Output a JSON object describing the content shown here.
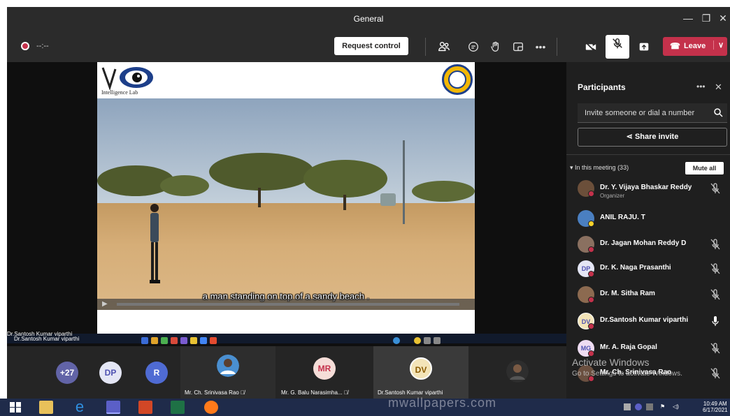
{
  "window": {
    "title": "General"
  },
  "toolbar": {
    "timer": "--:--",
    "request_control_label": "Request control",
    "leave_label": "Leave"
  },
  "slide": {
    "lab_name": "Intelligence Lab",
    "caption": "a man standing on top of a sandy beach ."
  },
  "presenter_name": "Dr.Santosh Kumar viparthi",
  "panel": {
    "title": "Participants",
    "search_placeholder": "Invite someone or dial a number",
    "share_invite_label": "Share invite",
    "in_meeting_label": "In this meeting (33)",
    "mute_all_label": "Mute all",
    "participants": [
      {
        "name": "Dr. Y. Vijaya Bhaskar Reddy",
        "role": "Organizer",
        "initials": "",
        "avatar_color": "#6b4f3a",
        "mic": "muted"
      },
      {
        "name": "ANIL RAJU. T",
        "role": "",
        "initials": "",
        "avatar_color": "#4a7fc1",
        "mic": "none"
      },
      {
        "name": "Dr. Jagan Mohan Reddy D",
        "role": "",
        "initials": "",
        "avatar_color": "#8a7060",
        "mic": "muted"
      },
      {
        "name": "Dr. K. Naga Prasanthi",
        "role": "",
        "initials": "DP",
        "avatar_color": "#e4e6f5",
        "mic": "muted"
      },
      {
        "name": "Dr. M. Sitha Ram",
        "role": "",
        "initials": "",
        "avatar_color": "#8c6a50",
        "mic": "muted"
      },
      {
        "name": "Dr.Santosh Kumar viparthi",
        "role": "",
        "initials": "DV",
        "avatar_color": "#f3e4b8",
        "mic": "on"
      },
      {
        "name": "Mr. A. Raja Gopal",
        "role": "",
        "initials": "MG",
        "avatar_color": "#eedcf2",
        "mic": "muted"
      },
      {
        "name": "Mr. Ch. Srinivasa Rao",
        "role": "",
        "initials": "",
        "avatar_color": "#6b5040",
        "mic": "muted"
      }
    ]
  },
  "gallery": {
    "overflow_label": "+27",
    "tiles": [
      {
        "initials": "DP",
        "label": ""
      },
      {
        "initials": "R",
        "label": ""
      },
      {
        "initials": "",
        "label": "Mr. Ch. Srinivasa Rao"
      },
      {
        "initials": "MR",
        "label": "Mr. G. Balu Narasimha..."
      },
      {
        "initials": "DV",
        "label": "Dr.Santosh Kumar viparthi"
      }
    ]
  },
  "watermark": {
    "activate_title": "Activate Windows",
    "activate_sub": "Go to Settings to activate Windows.",
    "site": "mwallpapers.com"
  },
  "taskbar": {
    "time": "10:49 AM",
    "date": "6/17/2021"
  },
  "colors": {
    "leave_red": "#c4314b",
    "panel_bg": "#1f1f1f",
    "toolbar_bg": "#2b2b2b"
  }
}
